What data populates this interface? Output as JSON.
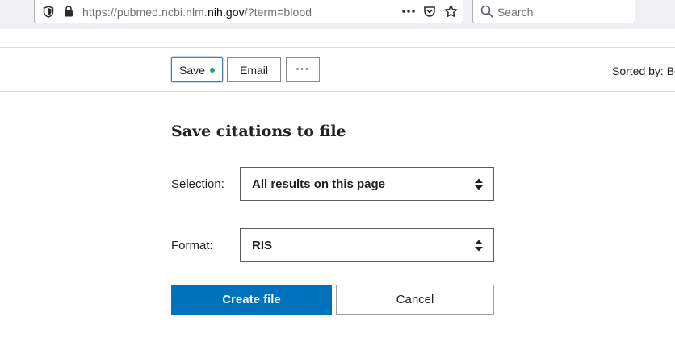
{
  "browser": {
    "url_prefix": "https://pubmed.ncbi.nlm.",
    "url_domain": "nih.gov",
    "url_suffix": "/?term=blood",
    "search_placeholder": "Search",
    "icons": [
      "shield-icon",
      "lock-icon",
      "more-icon",
      "pocket-icon",
      "bookmark-star-icon",
      "search-icon"
    ]
  },
  "toolbar": {
    "save_label": "Save",
    "email_label": "Email",
    "more_label": "···",
    "sorted_by": "Sorted by: Be"
  },
  "save_panel": {
    "title": "Save citations to file",
    "selection_label": "Selection:",
    "selection_value": "All results on this page",
    "format_label": "Format:",
    "format_value": "RIS",
    "create_label": "Create file",
    "cancel_label": "Cancel"
  },
  "colors": {
    "primary": "#0071bc",
    "save_indicator": "#20a36a"
  }
}
